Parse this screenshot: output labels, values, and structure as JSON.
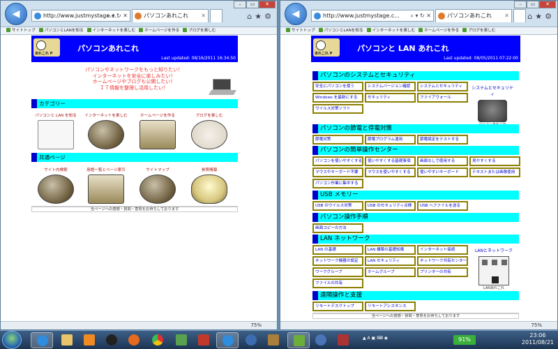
{
  "left": {
    "url": "http://www.justmystage.c...",
    "tab_title": "パソコンあれこれ",
    "favorites": [
      "サイトトップ",
      "パソコンとLANを知る",
      "インターネットを楽しむ",
      "ホームページを作る",
      "ブログを楽しむ"
    ],
    "header": {
      "title": "パソコンあれこれ",
      "updated": "Last updated: 08/16/2011 16:34:50",
      "logo_text": "あれこれ P"
    },
    "intro": [
      "パソコンやネットワークをもっと知りたい！",
      "インターネットを安全に楽しみたい！",
      "ホームページやブログも公開したい！",
      "ＩＴ情報を整理し活用したい！"
    ],
    "category_title": "カテゴリー",
    "categories": [
      "パソコンと LAN を知る",
      "インターネットを楽しむ",
      "ホームページを作る",
      "ブログを楽しむ"
    ],
    "common_title": "共通ページ",
    "common": [
      {
        "label": "サイト内検索",
        "caption": "サイト内検索"
      },
      {
        "label": "用語一覧とページ索引",
        "caption": ""
      },
      {
        "label": "サイトマップ",
        "caption": "サイトマップ"
      },
      {
        "label": "参照情報",
        "caption": "参 照 情 報"
      }
    ],
    "footer": "当ページへの感想・質問・意見をお待ちしております",
    "zoom": "75%"
  },
  "right": {
    "url": "http://www.justmystage.c...",
    "tab_title": "パソコンあれこれ",
    "favorites": [
      "サイトトップ",
      "パソコンとLANを知る",
      "インターネットを楽しむ",
      "ホームページを作る",
      "ブログを楽しむ"
    ],
    "header": {
      "title": "パソコンと LAN あれこれ",
      "updated": "Last updated: 08/05/2011 07:22:00",
      "logo_text": "あれこれ P"
    },
    "sections": [
      {
        "title": "パソコンのシステムとセキュリティ",
        "rows": [
          [
            "安全にパソコンを使う",
            "システムバージョン確認",
            "システムとセキュリティ"
          ],
          [
            "Windows を最新にする",
            "セキュリティ",
            "ファイアウォール"
          ],
          [
            "ウイルス対策ソフト"
          ]
        ]
      },
      {
        "title": "パソコンの節電と停電対策",
        "rows": [
          [
            "節電対策",
            "節電プログラム運用",
            "節電設定をテストする"
          ]
        ]
      },
      {
        "title": "パソコンの簡単操作センター",
        "rows": [
          [
            "パソコンを使いやすくする",
            "使いやすくする基礎事項",
            "画面なしで使用する",
            "見やすくする"
          ],
          [
            "マウスやキーボード不要",
            "マウスを使いやすくする",
            "使いやすいキーボード",
            "テキストまたは画像使用"
          ],
          [
            "パソコン作業に集中する"
          ]
        ]
      },
      {
        "title": "USB メモリー",
        "rows": [
          [
            "USB のウイルス対策",
            "USB のセキュリティ点検",
            "USB へファイルを送る"
          ]
        ]
      },
      {
        "title": "パソコン操作手順",
        "rows": [
          [
            "画面コピーの方法"
          ]
        ]
      },
      {
        "title": "LAN ネットワーク",
        "rows": [
          [
            "LAN の基礎",
            "LAN 構築の基礎知識",
            "インターネット接続"
          ],
          [
            "ネットワーク機器の設定",
            "LAN セキュリティ",
            "ネットワーク共有センター"
          ],
          [
            "ワークグループ",
            "ホームグループ",
            "プリンターの共有"
          ],
          [
            "ファイルの共有"
          ]
        ]
      },
      {
        "title": "遠隔操作と支援",
        "rows": [
          [
            "リモートデスクトップ",
            "リモートアシスタンス"
          ]
        ]
      }
    ],
    "side": {
      "system": "システムとセキュリティ",
      "lan": "LANとネットワーク",
      "pc_caption": "パソコンあれこれ",
      "lan_caption": "LANあれこれ"
    },
    "footer": "当ページへの感想・質問・意見をお待ちしております",
    "zoom": "75%"
  },
  "taskbar": {
    "battery": "91%",
    "time": "23:06",
    "date": "2011/08/21"
  }
}
